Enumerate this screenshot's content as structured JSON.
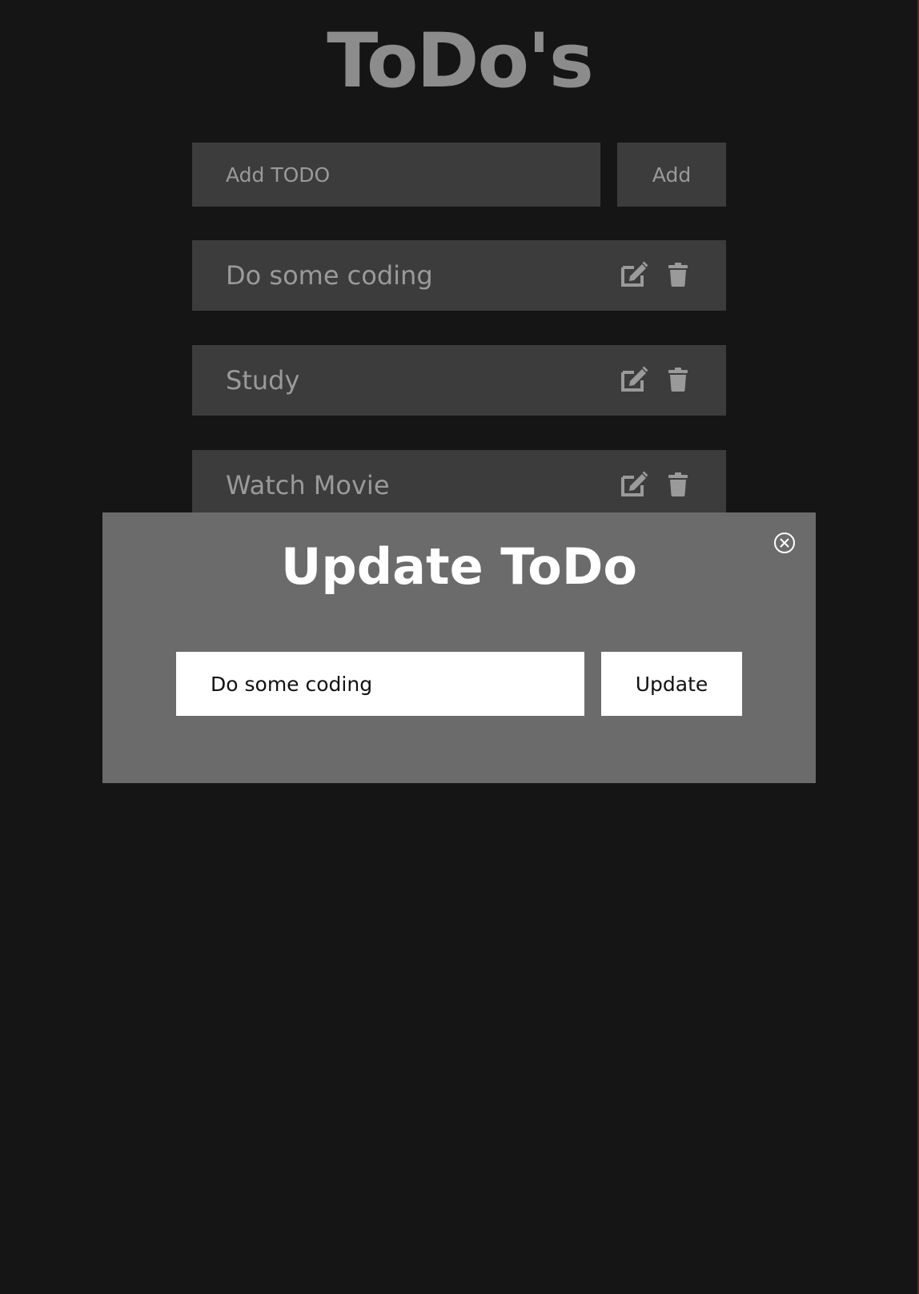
{
  "app": {
    "title": "ToDo's"
  },
  "add_form": {
    "placeholder": "Add TODO",
    "value": "",
    "button_label": "Add"
  },
  "todos": [
    {
      "text": "Do some coding",
      "edit_icon": "edit-icon",
      "delete_icon": "trash-icon"
    },
    {
      "text": "Study",
      "edit_icon": "edit-icon",
      "delete_icon": "trash-icon"
    },
    {
      "text": "Watch Movie",
      "edit_icon": "edit-icon",
      "delete_icon": "trash-icon"
    }
  ],
  "modal": {
    "title": "Update ToDo",
    "input_value": "Do some coding",
    "button_label": "Update",
    "close_icon": "close-circle-icon"
  },
  "colors": {
    "background": "#151515",
    "title": "#8c8c8c",
    "panel": "#3c3c3c",
    "muted_text": "#9a9a9a",
    "modal_bg": "#6b6b6b",
    "modal_text": "#ffffff"
  }
}
